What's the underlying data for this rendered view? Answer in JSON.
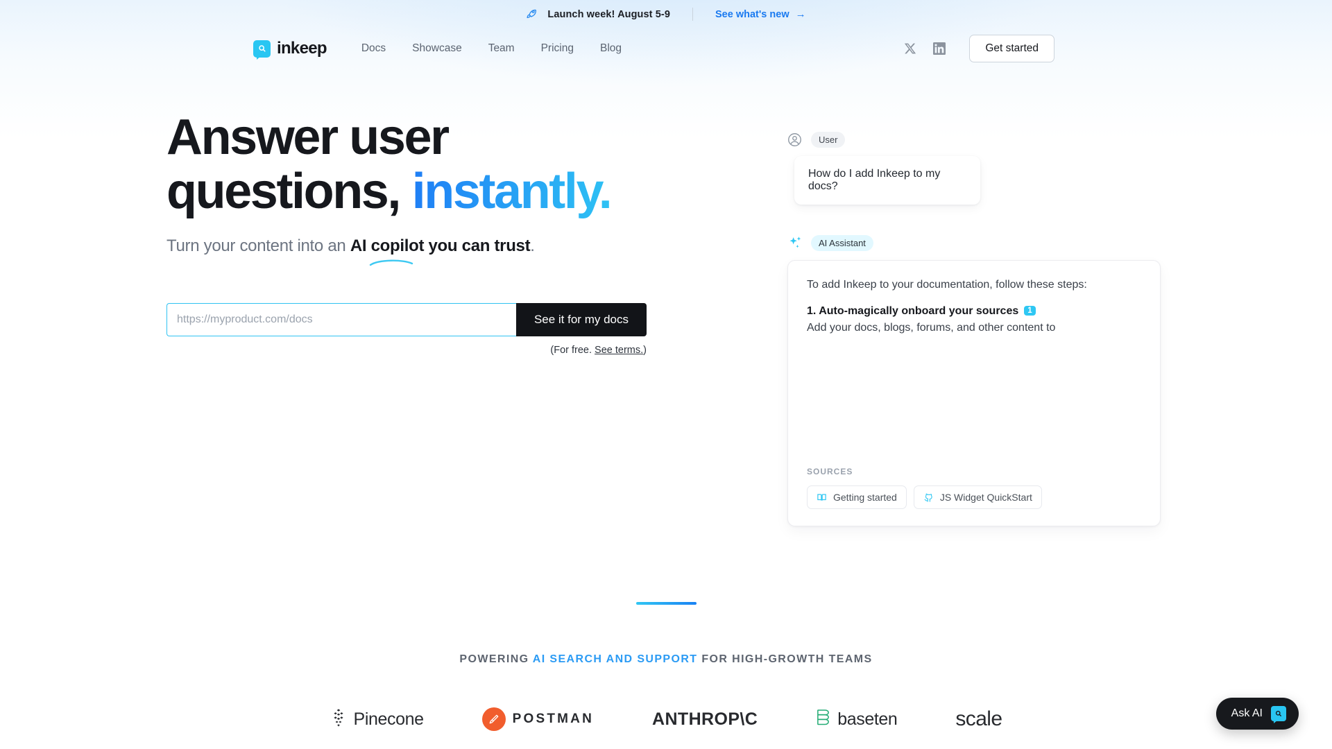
{
  "banner": {
    "icon": "rocket-icon",
    "text": "Launch week! August 5-9",
    "link_label": "See what's new",
    "link_arrow": "→"
  },
  "header": {
    "brand": "inkeep",
    "brand_icon": "inkeep-logo-icon",
    "nav_links": [
      {
        "label": "Docs"
      },
      {
        "label": "Showcase"
      },
      {
        "label": "Team"
      },
      {
        "label": "Pricing"
      },
      {
        "label": "Blog"
      }
    ],
    "socials": [
      {
        "name": "x-twitter-icon"
      },
      {
        "name": "linkedin-icon"
      }
    ],
    "cta_label": "Get started"
  },
  "hero": {
    "headline_line1": "Answer user",
    "headline_line2_plain": "questions,",
    "headline_line2_accent": "instantly.",
    "subhead_prefix": "Turn your content into an ",
    "subhead_bold": "AI copilot you can trust",
    "subhead_suffix": ".",
    "input_placeholder": "https://myproduct.com/docs",
    "input_value": "",
    "submit_label": "See it for my docs",
    "terms_prefix": "(For free. ",
    "terms_link": "See terms.",
    "terms_suffix": ")"
  },
  "chat": {
    "user": {
      "badge": "User",
      "avatar_icon": "user-avatar-icon",
      "message": "How do I add Inkeep to my docs?"
    },
    "assistant": {
      "badge": "AI Assistant",
      "icon": "sparkles-icon",
      "intro": "To add Inkeep to your documentation, follow these steps:",
      "step_title": "1. Auto-magically onboard your sources",
      "step_citation": "1",
      "step_body": "Add your docs, blogs, forums, and other content to",
      "sources_label": "SOURCES",
      "sources": [
        {
          "label": "Getting started",
          "icon": "book-icon"
        },
        {
          "label": "JS Widget QuickStart",
          "icon": "github-icon"
        }
      ]
    }
  },
  "social_proof": {
    "prefix": "POWERING ",
    "highlight": "AI SEARCH AND SUPPORT",
    "suffix": " FOR HIGH-GROWTH TEAMS",
    "logos": [
      {
        "name": "Pinecone",
        "icon": "pinecone-icon"
      },
      {
        "name": "POSTMAN",
        "icon": "postman-icon"
      },
      {
        "name": "ANTHROP\\C",
        "icon": ""
      },
      {
        "name": "baseten",
        "icon": "baseten-icon"
      },
      {
        "name": "scale",
        "icon": ""
      }
    ]
  },
  "fab": {
    "label": "Ask AI",
    "icon": "inkeep-logo-icon"
  },
  "colors": {
    "accent_cyan": "#2ec7f3",
    "accent_blue": "#1a7af0",
    "ink": "#16181d",
    "muted": "#6c7481",
    "postman_orange": "#f0501c",
    "baseten_green": "#12a66a"
  }
}
